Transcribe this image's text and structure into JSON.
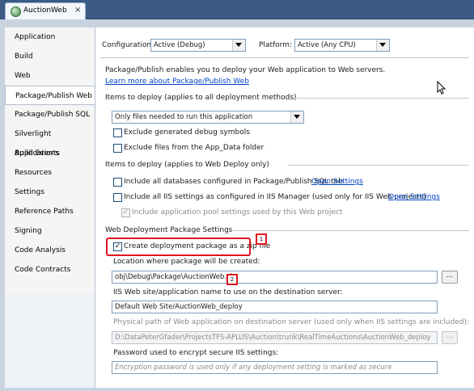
{
  "window": {
    "tab_title": "AuctionWeb",
    "tab_close": "×"
  },
  "sidebar": {
    "items": [
      {
        "label": "Application"
      },
      {
        "label": "Build"
      },
      {
        "label": "Web"
      },
      {
        "label": "Package/Publish Web",
        "active": true
      },
      {
        "label": "Package/Publish SQL"
      },
      {
        "label": "Silverlight Applications"
      },
      {
        "label": "Build Events"
      },
      {
        "label": "Resources"
      },
      {
        "label": "Settings"
      },
      {
        "label": "Reference Paths"
      },
      {
        "label": "Signing"
      },
      {
        "label": "Code Analysis"
      },
      {
        "label": "Code Contracts"
      }
    ]
  },
  "config": {
    "configuration_label": "Configuration:",
    "configuration_value": "Active (Debug)",
    "platform_label": "Platform:",
    "platform_value": "Active (Any CPU)"
  },
  "intro": {
    "text": "Package/Publish enables you to deploy your Web application to Web servers.",
    "link": "Learn more about Package/Publish Web"
  },
  "items_to_deploy": {
    "header": "Items to deploy (applies to all deployment methods)",
    "selected": "Only files needed to run this application",
    "exclude_debug": {
      "label": "Exclude generated debug symbols",
      "checked": false
    },
    "exclude_app_data": {
      "label": "Exclude files from the App_Data folder",
      "checked": false
    }
  },
  "web_deploy_items": {
    "header": "Items to deploy (applies to Web Deploy only)",
    "include_databases": {
      "label": "Include all databases configured in Package/Publish SQL tab",
      "link": "Open Settings",
      "checked": false
    },
    "include_iis": {
      "label": "Include all IIS settings as configured in IIS Manager (used only for IIS Web projects)",
      "link": "Open Settings",
      "checked": false
    },
    "include_app_pool": {
      "label": "Include application pool settings used by this Web project",
      "checked": true,
      "enabled": false
    }
  },
  "package_settings": {
    "header": "Web Deployment Package Settings",
    "create_zip": {
      "label": "Create deployment package as a zip file",
      "checked": true
    },
    "location_label": "Location where package will be created:",
    "location_value": "obj\\Debug\\Package\\AuctionWeb.zip",
    "iis_site_label": "IIS Web site/application name to use on the destination server:",
    "iis_site_value": "Default Web Site/AuctionWeb_deploy",
    "physical_path_label": "Physical path of Web application on destination server (used only when IIS settings are included):",
    "physical_path_value": "D:\\DataPeterGfader\\ProjectsTFS-APLUS\\Auction\\trunk\\RealTimeAuctions\\AuctionWeb_deploy",
    "password_label": "Password used to encrypt secure IIS settings:",
    "password_placeholder": "Encryption password is used only if any deployment setting is marked as secure",
    "browse_label": "..."
  },
  "callouts": {
    "one": "1",
    "two": "2"
  },
  "colors": {
    "accent_red": "#e0141e",
    "link_blue": "#0044cc",
    "tabbar": "#3b5a86"
  }
}
